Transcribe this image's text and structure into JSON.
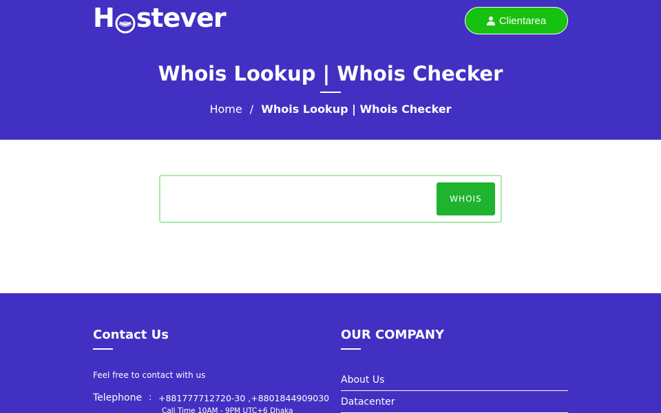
{
  "colors": {
    "brand_purple": "#4230c2",
    "button_green": "#17c10f",
    "whois_green": "#1fb32f",
    "search_border": "#a6ec9f",
    "text_white": "#ffffff"
  },
  "header": {
    "logo": {
      "prefix": "H",
      "suffix": "stever",
      "icon": "globe-o-logo-icon"
    },
    "client_button": {
      "label": "Clientarea",
      "icon": "user-icon"
    },
    "title": "Whois Lookup | Whois Checker",
    "breadcrumb": {
      "home": "Home",
      "separator": "/",
      "current": "Whois Lookup | Whois Checker"
    }
  },
  "search": {
    "input_value": "",
    "placeholder": "",
    "button_label": "WHOIS"
  },
  "footer": {
    "contact": {
      "heading": "Contact Us",
      "intro": "Feel free to contact with us",
      "telephone_label": "Telephone",
      "colon": ":",
      "telephone_numbers": "+881777712720-30 ,+8801844909030",
      "call_time": "Call Time 10AM - 9PM UTC+6 Dhaka"
    },
    "company": {
      "heading": "OUR COMPANY",
      "links": [
        "About Us",
        "Datacenter"
      ]
    }
  }
}
